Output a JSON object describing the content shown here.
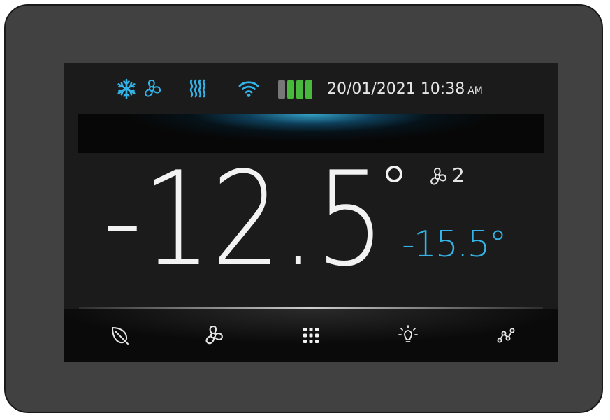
{
  "status": {
    "icons": [
      "snowflake-icon",
      "fan-icon",
      "heater-icon",
      "wifi-icon"
    ],
    "signal_level": 0.75,
    "date": "20/01/2021",
    "time": "10:38",
    "ampm": "AM"
  },
  "main": {
    "temperature": "-12.5",
    "fan_speed": "2",
    "setpoint": "-15.5°"
  },
  "nav": {
    "items": [
      "eco-leaf-icon",
      "fan-icon",
      "menu-grid-icon",
      "light-bulb-icon",
      "graph-icon"
    ]
  },
  "colors": {
    "accent_blue": "#33b3e8",
    "signal_green": "#49b93e",
    "signal_gray": "#777777",
    "text_white": "#f2f2f2",
    "bezel": "#414141",
    "screen": "#1b1b1b"
  }
}
